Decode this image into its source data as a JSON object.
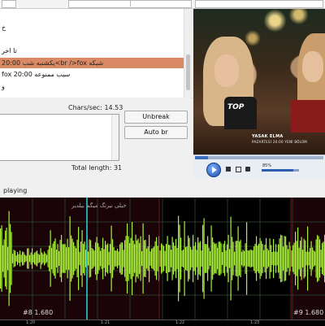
{
  "subtitles": [
    {
      "text": "خ",
      "selected": false
    },
    {
      "text": "تا اخر",
      "selected": false
    },
    {
      "text": "20:00 یکشنبه شب<br />fox شبکه",
      "selected": true
    },
    {
      "text": "fox 20:00 سیب ممنوعه",
      "selected": false
    },
    {
      "text": "و",
      "selected": false
    }
  ],
  "editor": {
    "chars_per_sec": "Chars/sec: 14.53",
    "unbreak_label": "Unbreak",
    "auto_br_label": "Auto br",
    "total_length": "Total length: 31"
  },
  "video": {
    "caption_line1": "YASAK ELMA",
    "caption_line2": "PAZARTESİ 20:00   YENİ BÖLÜM",
    "shirt_logo": "TOP"
  },
  "player": {
    "volume": "85%",
    "volume_level": 0.85
  },
  "waveform": {
    "status": "playing",
    "label": "خیلی نیرنگ میگم بیلدیر",
    "marker_left": "#8 1.680",
    "marker_right": "#9 1.680",
    "ticks": [
      "1:20",
      "1:21",
      "1:22",
      "1:23"
    ],
    "colors": {
      "wave": "#a8f03a",
      "cursor": "#2bd9e0",
      "subtitle_region": "#3a0a12"
    }
  }
}
